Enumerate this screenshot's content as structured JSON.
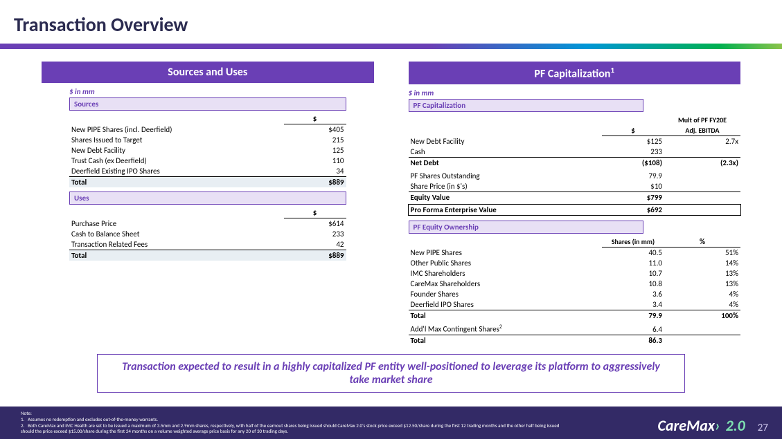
{
  "title": "Transaction Overview",
  "left": {
    "header": "Sources and Uses",
    "unit": "$ in mm",
    "sources_label": "Sources",
    "dollar": "$",
    "sources": {
      "r1": {
        "label": "New PIPE Shares (incl. Deerfield)",
        "val": "$405"
      },
      "r2": {
        "label": "Shares Issued to Target",
        "val": "215"
      },
      "r3": {
        "label": "New Debt Facility",
        "val": "125"
      },
      "r4": {
        "label": "Trust Cash (ex Deerfield)",
        "val": "110"
      },
      "r5": {
        "label": "Deerfield Existing IPO Shares",
        "val": "34"
      },
      "total": {
        "label": "Total",
        "val": "$889"
      }
    },
    "uses_label": "Uses",
    "uses": {
      "r1": {
        "label": "Purchase Price",
        "val": "$614"
      },
      "r2": {
        "label": "Cash to Balance Sheet",
        "val": "233"
      },
      "r3": {
        "label": "Transaction Related Fees",
        "val": "42"
      },
      "total": {
        "label": "Total",
        "val": "$889"
      }
    }
  },
  "right": {
    "header": "PF Capitalization",
    "header_sup": "1",
    "unit": "$ in mm",
    "cap_label": "PF Capitalization",
    "cap_col1": "$",
    "cap_col2_a": "Mult of PF FY20E",
    "cap_col2_b": "Adj. EBITDA",
    "cap": {
      "r1": {
        "label": "New Debt Facility",
        "v1": "$125",
        "v2": "2.7x"
      },
      "r2": {
        "label": "Cash",
        "v1": "233",
        "v2": ""
      },
      "net": {
        "label": "Net Debt",
        "v1": "($108)",
        "v2": "(2.3x)"
      },
      "r3": {
        "label": "PF Shares Outstanding",
        "v1": "79.9",
        "v2": ""
      },
      "r4": {
        "label": "Share Price (in $'s)",
        "v1": "$10",
        "v2": ""
      },
      "eq": {
        "label": "Equity Value",
        "v1": "$799",
        "v2": ""
      },
      "ev": {
        "label": "Pro Forma Enterprise Value",
        "v1": "$692",
        "v2": ""
      }
    },
    "own_label": "PF Equity Ownership",
    "own_col1": "Shares (in mm)",
    "own_col2": "%",
    "own": {
      "r1": {
        "label": "New PIPE Shares",
        "v1": "40.5",
        "v2": "51%"
      },
      "r2": {
        "label": "Other Public Shares",
        "v1": "11.0",
        "v2": "14%"
      },
      "r3": {
        "label": "IMC Shareholders",
        "v1": "10.7",
        "v2": "13%"
      },
      "r4": {
        "label": "CareMax Shareholders",
        "v1": "10.8",
        "v2": "13%"
      },
      "r5": {
        "label": "Founder Shares",
        "v1": "3.6",
        "v2": "4%"
      },
      "r6": {
        "label": "Deerfield IPO Shares",
        "v1": "3.4",
        "v2": "4%"
      },
      "total": {
        "label": "Total",
        "v1": "79.9",
        "v2": "100%"
      },
      "addl": {
        "label": "Add'l Max Contingent Shares",
        "sup": "2",
        "v1": "6.4",
        "v2": ""
      },
      "grand": {
        "label": "Total",
        "v1": "86.3",
        "v2": ""
      }
    }
  },
  "callout": "Transaction expected to result in a highly capitalized PF entity well-positioned to leverage its platform to aggressively take market share",
  "footer": {
    "note_label": "Note:",
    "fn1_num": "1.",
    "fn1": "Assumes no redemption and excludes out-of-the-money warrants.",
    "fn2_num": "2.",
    "fn2": "Both CareMax and IMC Health are set to be issued a maximum of 3.5mm and 2.9mm shares, respectively, with half of the earnout shares being issued should CareMax 2.0's stock price exceed $12.50/share during the first 12 trading months and the other half being issued should the price exceed $15.00/share during the first 24 months on a volume weighted average price basis for any 20 of 30 trading days.",
    "brand": "CareMax",
    "version": "2.0",
    "page": "27"
  }
}
